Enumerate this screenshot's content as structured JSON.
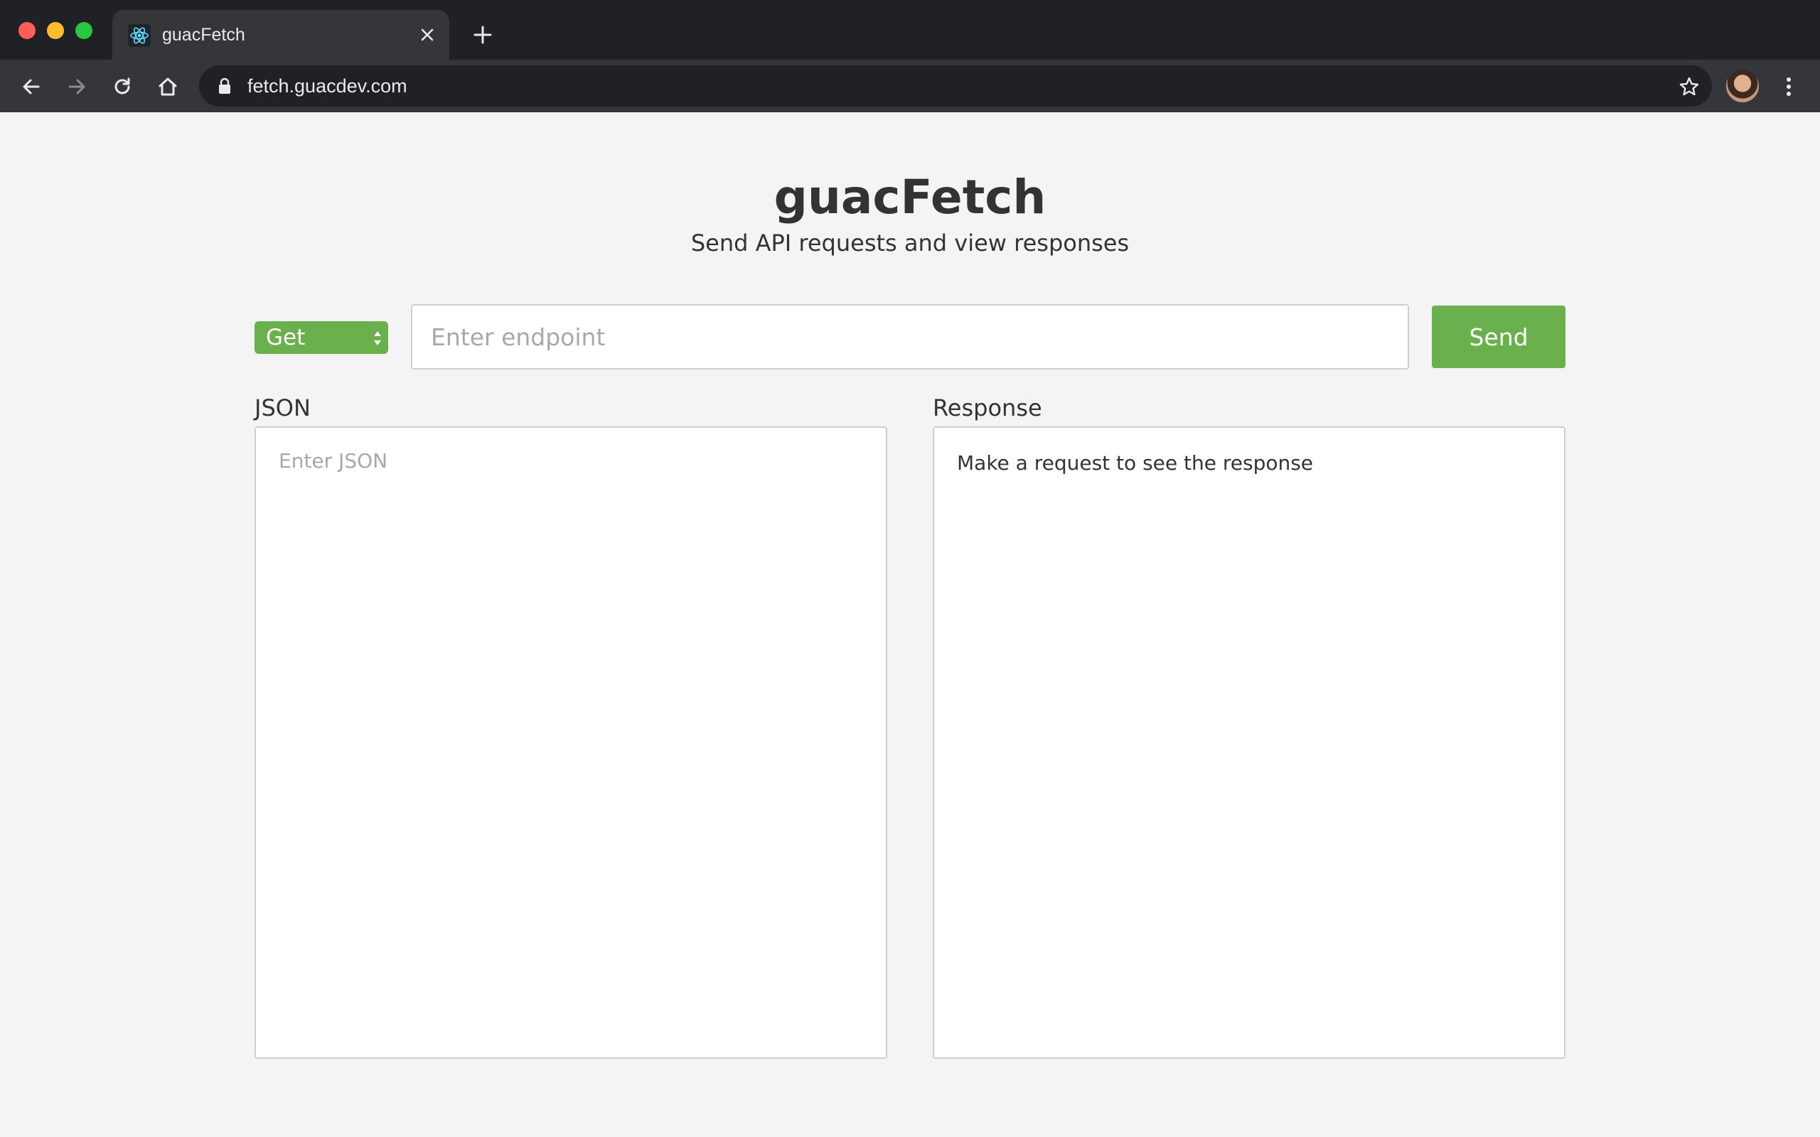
{
  "browser": {
    "tab": {
      "title": "guacFetch",
      "favicon": "react-atom-icon"
    },
    "url": "fetch.guacdev.com"
  },
  "header": {
    "title": "guacFetch",
    "subtitle": "Send API requests and view responses"
  },
  "request": {
    "method": "Get",
    "endpoint_placeholder": "Enter endpoint",
    "send_label": "Send"
  },
  "json_pane": {
    "label": "JSON",
    "placeholder": "Enter JSON"
  },
  "response_pane": {
    "label": "Response",
    "text": "Make a request to see the response"
  },
  "colors": {
    "accent": "#6ab04c",
    "chrome_dark": "#202124",
    "chrome_toolbar": "#35363a",
    "page_bg": "#f4f4f4"
  }
}
